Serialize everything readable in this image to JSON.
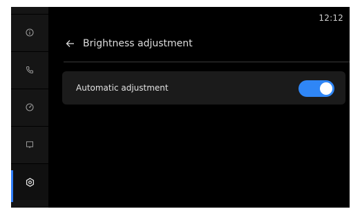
{
  "status_bar": {
    "time": "12:12"
  },
  "nav_rail": {
    "items": [
      {
        "icon": "info-icon"
      },
      {
        "icon": "phone-icon"
      },
      {
        "icon": "speed-icon"
      },
      {
        "icon": "display-icon"
      },
      {
        "icon": "settings-icon",
        "selected": true
      }
    ]
  },
  "header": {
    "title": "Brightness adjustment",
    "back_icon": "back-arrow-icon"
  },
  "settings": {
    "automatic_adjustment": {
      "label": "Automatic adjustment",
      "enabled": true
    }
  },
  "colors": {
    "accent": "#2f86f6",
    "background": "#000000",
    "card": "#1b1b1b",
    "rail": "#151515"
  }
}
